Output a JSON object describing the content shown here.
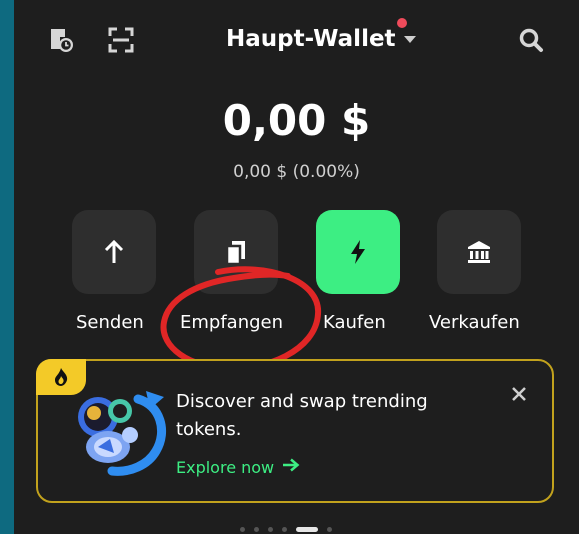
{
  "header": {
    "wallet_title": "Haupt-Wallet",
    "icons": [
      "history-icon",
      "scan-icon",
      "chevron-down-icon",
      "search-icon"
    ],
    "notification_dot_color": "#ef4b5b"
  },
  "balance": {
    "amount": "0,00 $",
    "change": "0,00 $ (0.00%)"
  },
  "actions": [
    {
      "label": "Senden",
      "icon": "arrow-up-icon"
    },
    {
      "label": "Empfangen",
      "icon": "copy-icon"
    },
    {
      "label": "Kaufen",
      "icon": "lightning-icon",
      "accent": "#3dee83"
    },
    {
      "label": "Verkaufen",
      "icon": "bank-icon"
    }
  ],
  "promo": {
    "title": "Discover and swap trending tokens.",
    "link": "Explore now",
    "badge_icon": "fire-icon",
    "border_color": "#c2a21d",
    "link_color": "#3dee83"
  },
  "annotation": {
    "color": "#e02626",
    "target": "Empfangen"
  },
  "pager": {
    "count": 6,
    "active_index": 4
  }
}
